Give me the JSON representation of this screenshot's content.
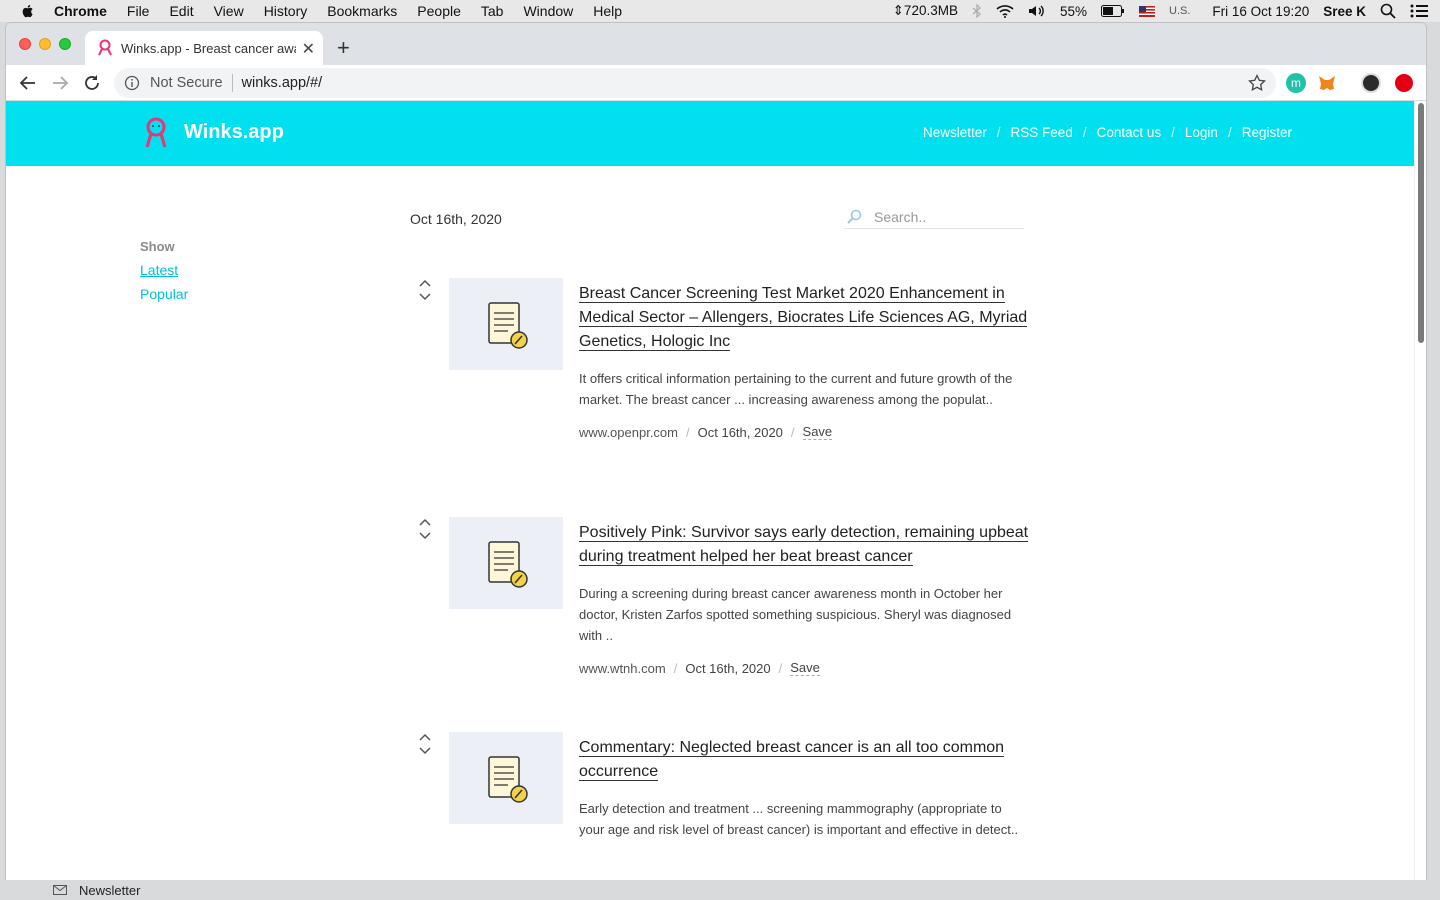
{
  "menubar": {
    "app_name": "Chrome",
    "items": [
      "File",
      "Edit",
      "View",
      "History",
      "Bookmarks",
      "People",
      "Tab",
      "Window",
      "Help"
    ],
    "memory": "⇕720.3MB",
    "battery": "55%",
    "input_source": "U.S.",
    "datetime": "Fri 16 Oct  19:20",
    "user": "Sree K"
  },
  "browser": {
    "tab_title": "Winks.app - Breast cancer awareness",
    "security_label": "Not Secure",
    "url": "winks.app/#/"
  },
  "site": {
    "logo_text": "Winks.app",
    "brand_color": "#00e0ef",
    "nav": [
      "Newsletter",
      "RSS Feed",
      "Contact us",
      "Login",
      "Register"
    ]
  },
  "sidebar": {
    "heading": "Show",
    "links": [
      "Latest",
      "Popular"
    ]
  },
  "main": {
    "date_heading": "Oct 16th, 2020",
    "search_placeholder": "Search.."
  },
  "articles": [
    {
      "title": "Breast Cancer Screening Test Market 2020 Enhancement in Medical Sector – Allengers, Biocrates Life Sciences AG, Myriad Genetics, Hologic Inc",
      "description": "It offers critical information pertaining to the current and future growth of the market. The breast cancer ... increasing awareness among the populat..",
      "source": "www.openpr.com",
      "date": "Oct 16th, 2020",
      "action": "Save"
    },
    {
      "title": "Positively Pink: Survivor says early detection, remaining upbeat during treatment helped her beat breast cancer",
      "description": "During a screening during breast cancer awareness month in October her doctor, Kristen Zarfos spotted something suspicious. Sheryl was diagnosed with ..",
      "source": "www.wtnh.com",
      "date": "Oct 16th, 2020",
      "action": "Save"
    },
    {
      "title": "Commentary: Neglected breast cancer is an all too common occurrence",
      "description": "Early detection and treatment ... screening mammography (appropriate to your age and risk level of breast cancer) is important and effective in detect..",
      "source": "",
      "date": "",
      "action": ""
    }
  ],
  "footer_strip": {
    "label": "Newsletter"
  }
}
